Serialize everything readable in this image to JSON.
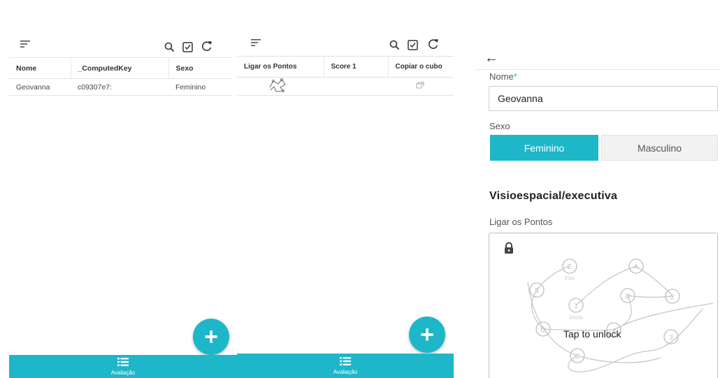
{
  "panels": {
    "left": "D",
    "right": "E"
  },
  "screen_d1": {
    "columns": [
      "Nome",
      "_ComputedKey",
      "Sexo"
    ],
    "rows": [
      [
        "Geovanna",
        "c09307e7:",
        "Feminino"
      ]
    ],
    "fab_symbol": "+",
    "bottom_nav": {
      "icon": "list-icon",
      "label": "Avaliação"
    }
  },
  "screen_d2": {
    "columns": [
      "Ligar os Pontos",
      "Score 1",
      "Copiar o cubo"
    ],
    "fab_symbol": "+",
    "bottom_nav": {
      "icon": "list-icon",
      "label": "Avaliação"
    }
  },
  "screen_e": {
    "back_symbol": "←",
    "name_label": "Nome",
    "required_mark": "*",
    "name_value": "Geovanna",
    "sex_label": "Sexo",
    "sex_options": [
      "Feminino",
      "Masculino"
    ],
    "sex_selected": "Feminino",
    "section_title": "Visioespacial/executiva",
    "canvas_label": "Ligar os Pontos",
    "lock_text": "Tap to unlock",
    "trail_nodes": [
      "E",
      "A",
      "5",
      "B",
      "2",
      "1",
      "D",
      "4",
      "3",
      "C"
    ],
    "trail_captions": [
      "Fim",
      "Início"
    ]
  },
  "colors": {
    "accent": "#1eb6c9",
    "required": "#1eb6c9"
  }
}
